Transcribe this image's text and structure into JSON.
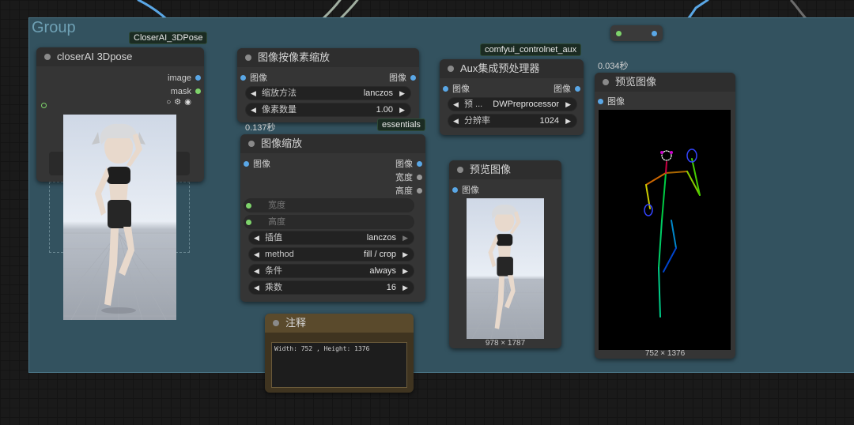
{
  "group": {
    "title": "Group"
  },
  "tags": {
    "closerai_3dpose": "CloserAI_3DPose",
    "controlnet_aux": "comfyui_controlnet_aux",
    "essentials": "essentials"
  },
  "timings": {
    "scale_by_pixels": "0.137秒",
    "preview_pose": "0.034秒"
  },
  "nodes": {
    "closerai_3dpose": {
      "title": "closerAI 3Dpose",
      "outputs": [
        "image",
        "mask"
      ]
    },
    "scale_by_pixels": {
      "title": "图像按像素缩放",
      "input": "图像",
      "output": "图像",
      "widgets": [
        {
          "label": "缩放方法",
          "value": "lanczos"
        },
        {
          "label": "像素数量",
          "value": "1.00"
        }
      ]
    },
    "aux_preprocessor": {
      "title": "Aux集成预处理器",
      "input": "图像",
      "output": "图像",
      "widgets": [
        {
          "label": "预 ...",
          "value": "DWPreprocessor"
        },
        {
          "label": "分辨率",
          "value": "1024"
        }
      ]
    },
    "image_scale": {
      "title": "图像缩放",
      "input": "图像",
      "outputs": [
        "图像",
        "宽度",
        "高度"
      ],
      "disabled_widgets": [
        "宽度",
        "高度"
      ],
      "widgets": [
        {
          "label": "插值",
          "value": "lanczos"
        },
        {
          "label": "method",
          "value": "fill / crop"
        },
        {
          "label": "条件",
          "value": "always"
        },
        {
          "label": "乘数",
          "value": "16"
        }
      ]
    },
    "preview_image": {
      "title": "预览图像",
      "input": "图像",
      "dims": "978 × 1787"
    },
    "preview_pose": {
      "title": "预览图像",
      "input": "图像",
      "dims": "752 × 1376"
    },
    "note": {
      "title": "注释",
      "text": "Width: 752 , Height: 1376"
    }
  },
  "colors": {
    "image_link": "#5aa7e6",
    "mask_link": "#7ed36b",
    "group_bg": "#33525f",
    "node_bg": "#353535",
    "note_title": "#5a4a2c"
  }
}
